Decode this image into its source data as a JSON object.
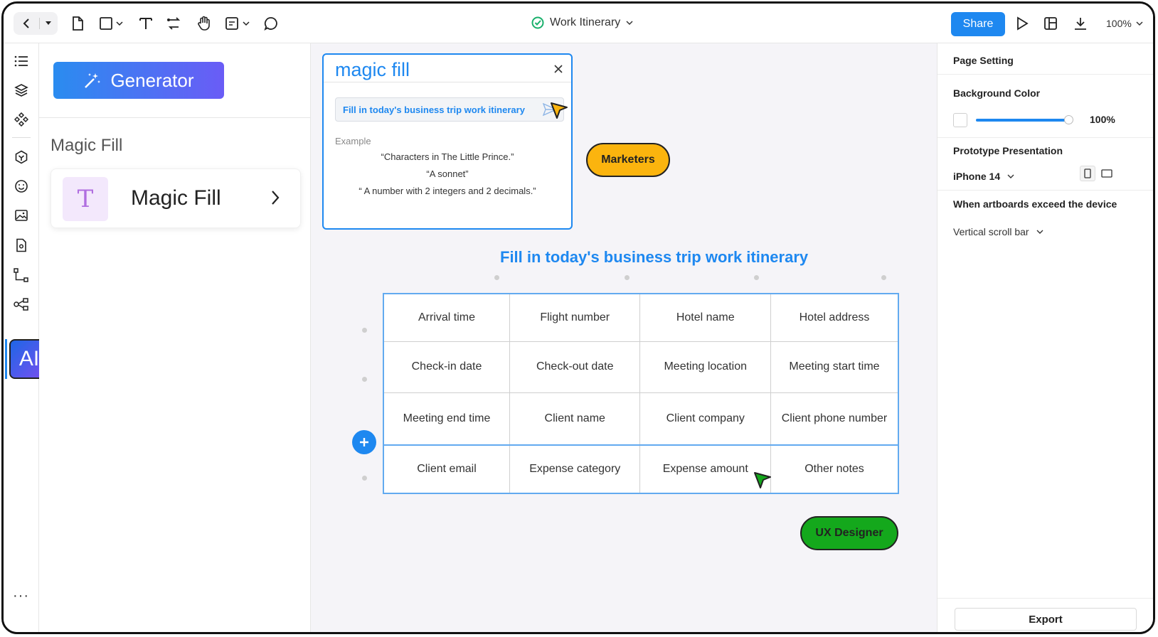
{
  "toolbar": {
    "doc_title": "Work Itinerary",
    "share_label": "Share",
    "zoom": "100%",
    "status_color": "#1ab06c"
  },
  "left_panel": {
    "generator_label": "Generator",
    "section_title": "Magic Fill",
    "card_label": "Magic Fill",
    "card_icon_glyph": "T"
  },
  "rail": {
    "ai_label": "AI",
    "more_label": "···"
  },
  "popup": {
    "title": "magic fill",
    "input_value": "Fill in today's business trip work itinerary",
    "example_label": "Example",
    "examples": [
      "“Characters in The Little Prince.”",
      "“A sonnet”",
      "“ A number with 2 integers and 2 decimals.”"
    ]
  },
  "collaborators": {
    "marketers": "Marketers",
    "ux_designer": "UX Designer",
    "marketers_color": "#fbb40e",
    "ux_color": "#14a81c"
  },
  "table": {
    "title": "Fill in today's business trip work itinerary",
    "rows": [
      [
        "Arrival time",
        "Flight number",
        "Hotel name",
        "Hotel address"
      ],
      [
        "Check-in date",
        "Check-out date",
        "Meeting location",
        "Meeting start time"
      ],
      [
        "Meeting end time",
        "Client name",
        "Client company",
        "Client phone number"
      ],
      [
        "Client email",
        "Expense category",
        "Expense amount",
        "Other notes"
      ]
    ]
  },
  "right_panel": {
    "page_setting": "Page Setting",
    "background_color": "Background Color",
    "opacity": "100%",
    "prototype_presentation": "Prototype Presentation",
    "device": "iPhone 14",
    "exceed_title": "When artboards exceed the device",
    "scroll_option": "Vertical scroll bar",
    "export_label": "Export"
  },
  "accent_color": "#1e88f0"
}
